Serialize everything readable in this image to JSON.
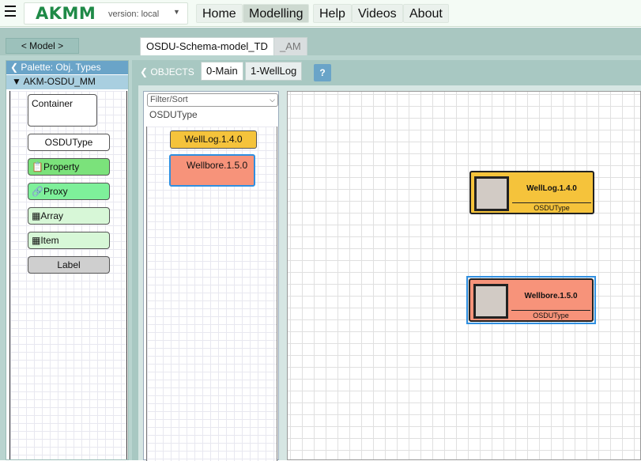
{
  "header": {
    "brand": "AKMM",
    "version": "version: local",
    "nav": [
      "Home",
      "Modelling",
      "Help",
      "Videos",
      "About"
    ],
    "active_nav": "Modelling"
  },
  "subbar": {
    "model_tab": "< Model >",
    "doc_tabs": [
      "OSDU-Schema-model_TD",
      "_AM"
    ]
  },
  "palette": {
    "header": "Palette: Obj. Types",
    "metamodel": "AKM-OSDU_MM",
    "items": [
      "Container",
      "OSDUType",
      "Property",
      "Proxy",
      "Array",
      "Item",
      "Label"
    ]
  },
  "tabs": {
    "objects": "OBJECTS",
    "pages": [
      "0-Main",
      "1-WellLog"
    ],
    "help": "?"
  },
  "objects_panel": {
    "filter_placeholder": "Filter/Sort",
    "type": "OSDUType",
    "items": [
      "WellLog.1.4.0",
      "Wellbore.1.5.0"
    ]
  },
  "diagram": {
    "nodes": [
      {
        "name": "WellLog.1.4.0",
        "type": "OSDUType",
        "color": "#f5c33b"
      },
      {
        "name": "Wellbore.1.5.0",
        "type": "OSDUType",
        "color": "#f7937a"
      }
    ]
  },
  "colors": {
    "brand": "#1f8a47",
    "accent_blue": "#6aa4c8",
    "selection": "#2f8fe0",
    "property": "#7be27b",
    "proxy": "#7ef09a",
    "light_green": "#d7f7d7",
    "label_gray": "#cfcfcf"
  }
}
